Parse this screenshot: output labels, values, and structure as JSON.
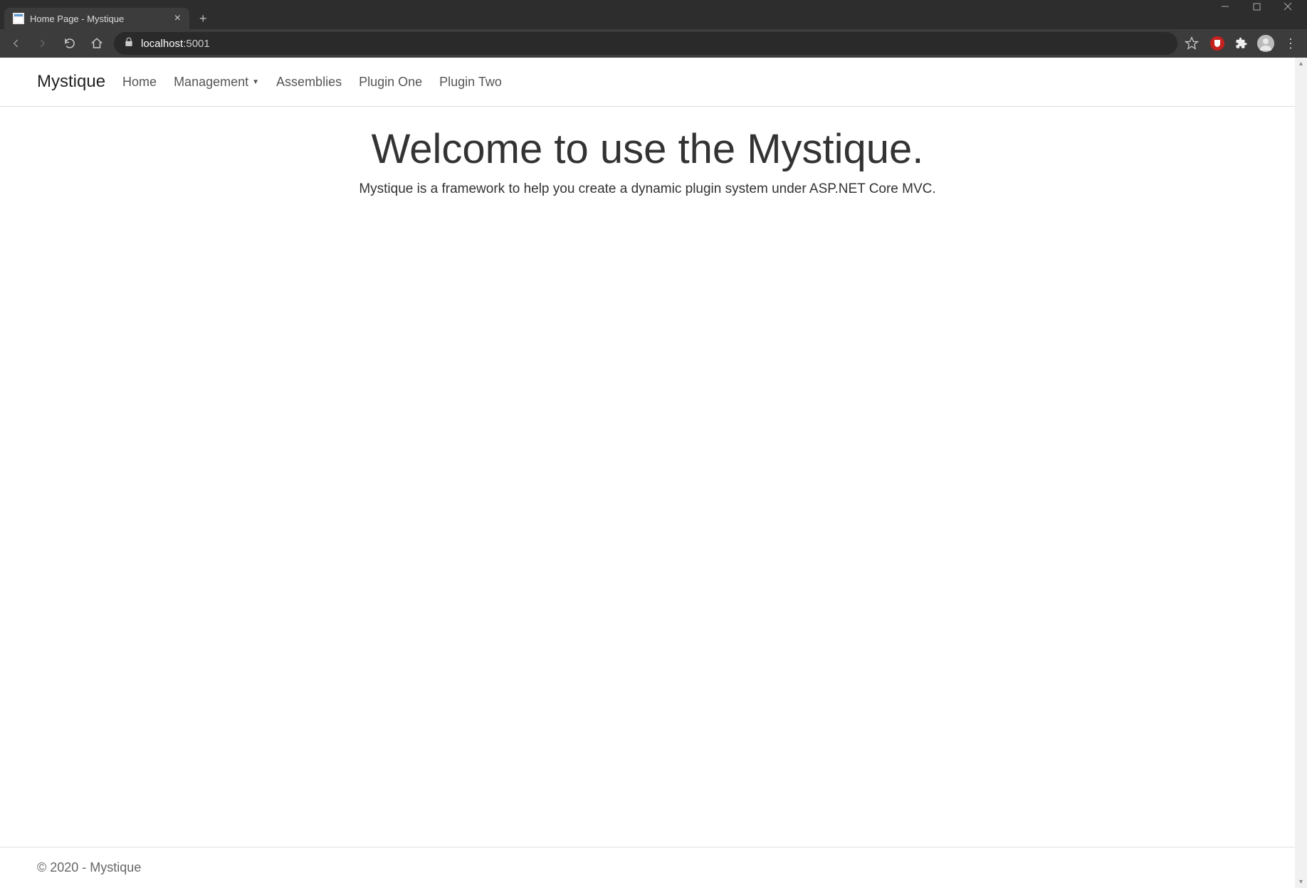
{
  "browser": {
    "tab_title": "Home Page - Mystique",
    "url_host": "localhost",
    "url_port": ":5001"
  },
  "navbar": {
    "brand": "Mystique",
    "links": [
      {
        "label": "Home"
      },
      {
        "label": "Management",
        "dropdown": true
      },
      {
        "label": "Assemblies"
      },
      {
        "label": "Plugin One"
      },
      {
        "label": "Plugin Two"
      }
    ]
  },
  "main": {
    "headline": "Welcome to use the Mystique.",
    "subhead": "Mystique is a framework to help you create a dynamic plugin system under ASP.NET Core MVC."
  },
  "footer": {
    "text": "© 2020 - Mystique"
  }
}
